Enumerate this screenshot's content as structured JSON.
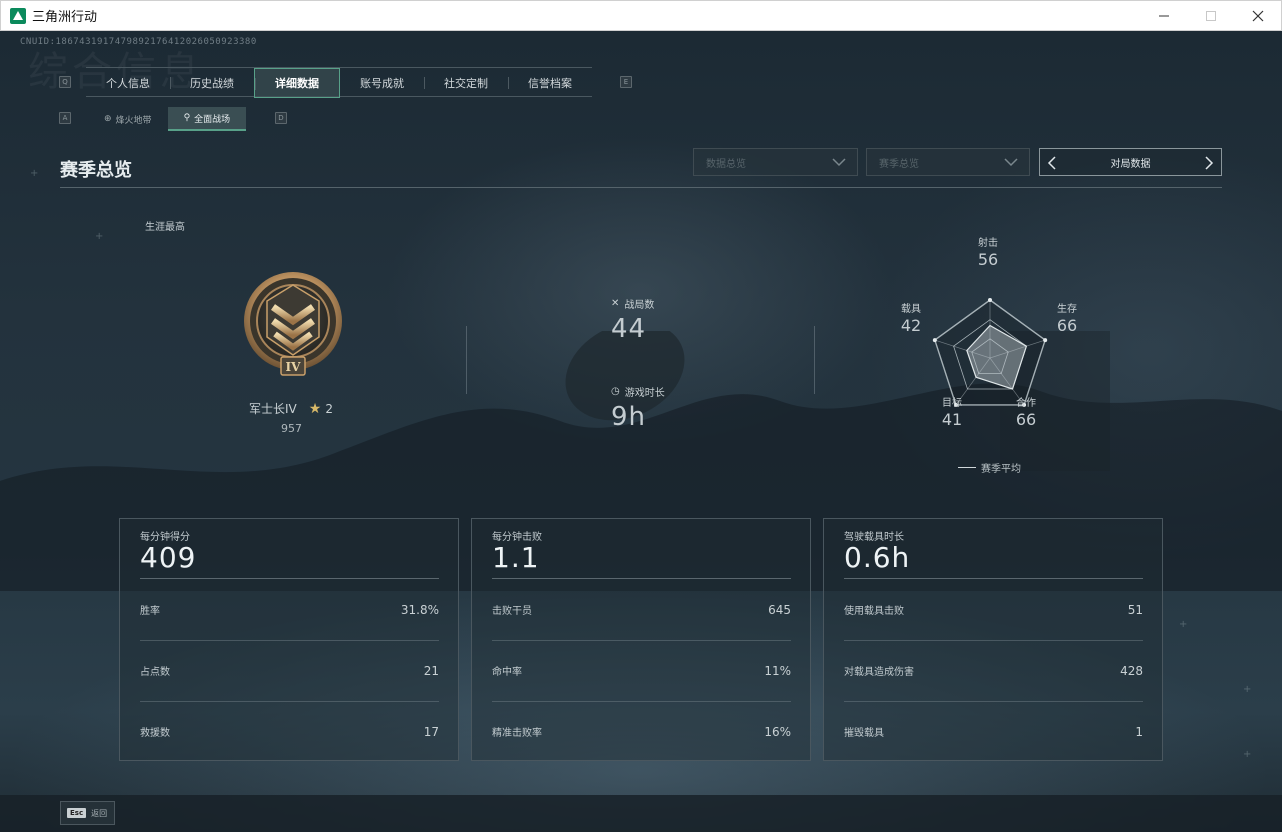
{
  "window": {
    "title": "三角洲行动",
    "controls": [
      "minimize",
      "maximize",
      "close"
    ]
  },
  "uid": "CNUID:1867431917479892176412026050923380",
  "watermark": "综合信息",
  "tabs": {
    "key_left": "Q",
    "key_right": "E",
    "items": [
      {
        "label": "个人信息",
        "active": false
      },
      {
        "label": "历史战绩",
        "active": false
      },
      {
        "label": "详细数据",
        "active": true
      },
      {
        "label": "账号成就",
        "active": false
      },
      {
        "label": "社交定制",
        "active": false
      },
      {
        "label": "信誉档案",
        "active": false
      }
    ]
  },
  "subtabs": {
    "key_left": "A",
    "key_right": "D",
    "items": [
      {
        "label": "烽火地带",
        "icon": "⊕",
        "active": false
      },
      {
        "label": "全面战场",
        "icon": "⚲",
        "active": true
      }
    ]
  },
  "section": {
    "title": "赛季总览",
    "dropdown1": "数据总览",
    "dropdown2": "赛季总览",
    "nav_label": "对局数据"
  },
  "career": {
    "label": "生涯最高",
    "rank": "军士长IV",
    "stars": "2",
    "score": "957",
    "badge_numeral": "IV"
  },
  "summary": {
    "matches_label": "战局数",
    "matches_value": "44",
    "playtime_label": "游戏时长",
    "playtime_value": "9h"
  },
  "radar": {
    "axes": [
      {
        "label": "射击",
        "value": 56
      },
      {
        "label": "生存",
        "value": 66
      },
      {
        "label": "合作",
        "value": 66
      },
      {
        "label": "目标",
        "value": 41
      },
      {
        "label": "载具",
        "value": 42
      }
    ],
    "legend": "赛季平均"
  },
  "cards": [
    {
      "head": "每分钟得分",
      "value": "409",
      "rows": [
        {
          "label": "胜率",
          "value": "31.8%"
        },
        {
          "label": "占点数",
          "value": "21"
        },
        {
          "label": "救援数",
          "value": "17"
        }
      ]
    },
    {
      "head": "每分钟击败",
      "value": "1.1",
      "rows": [
        {
          "label": "击败干员",
          "value": "645"
        },
        {
          "label": "命中率",
          "value": "11%"
        },
        {
          "label": "精准击败率",
          "value": "16%"
        }
      ]
    },
    {
      "head": "驾驶载具时长",
      "value": "0.6h",
      "rows": [
        {
          "label": "使用载具击败",
          "value": "51"
        },
        {
          "label": "对载具造成伤害",
          "value": "428"
        },
        {
          "label": "摧毁载具",
          "value": "1"
        }
      ]
    }
  ],
  "footer": {
    "esc_key": "Esc",
    "esc_label": "返回"
  },
  "colors": {
    "accent": "#58a189",
    "background": "#1f2c34",
    "badge_gold": "#c9a06a"
  }
}
